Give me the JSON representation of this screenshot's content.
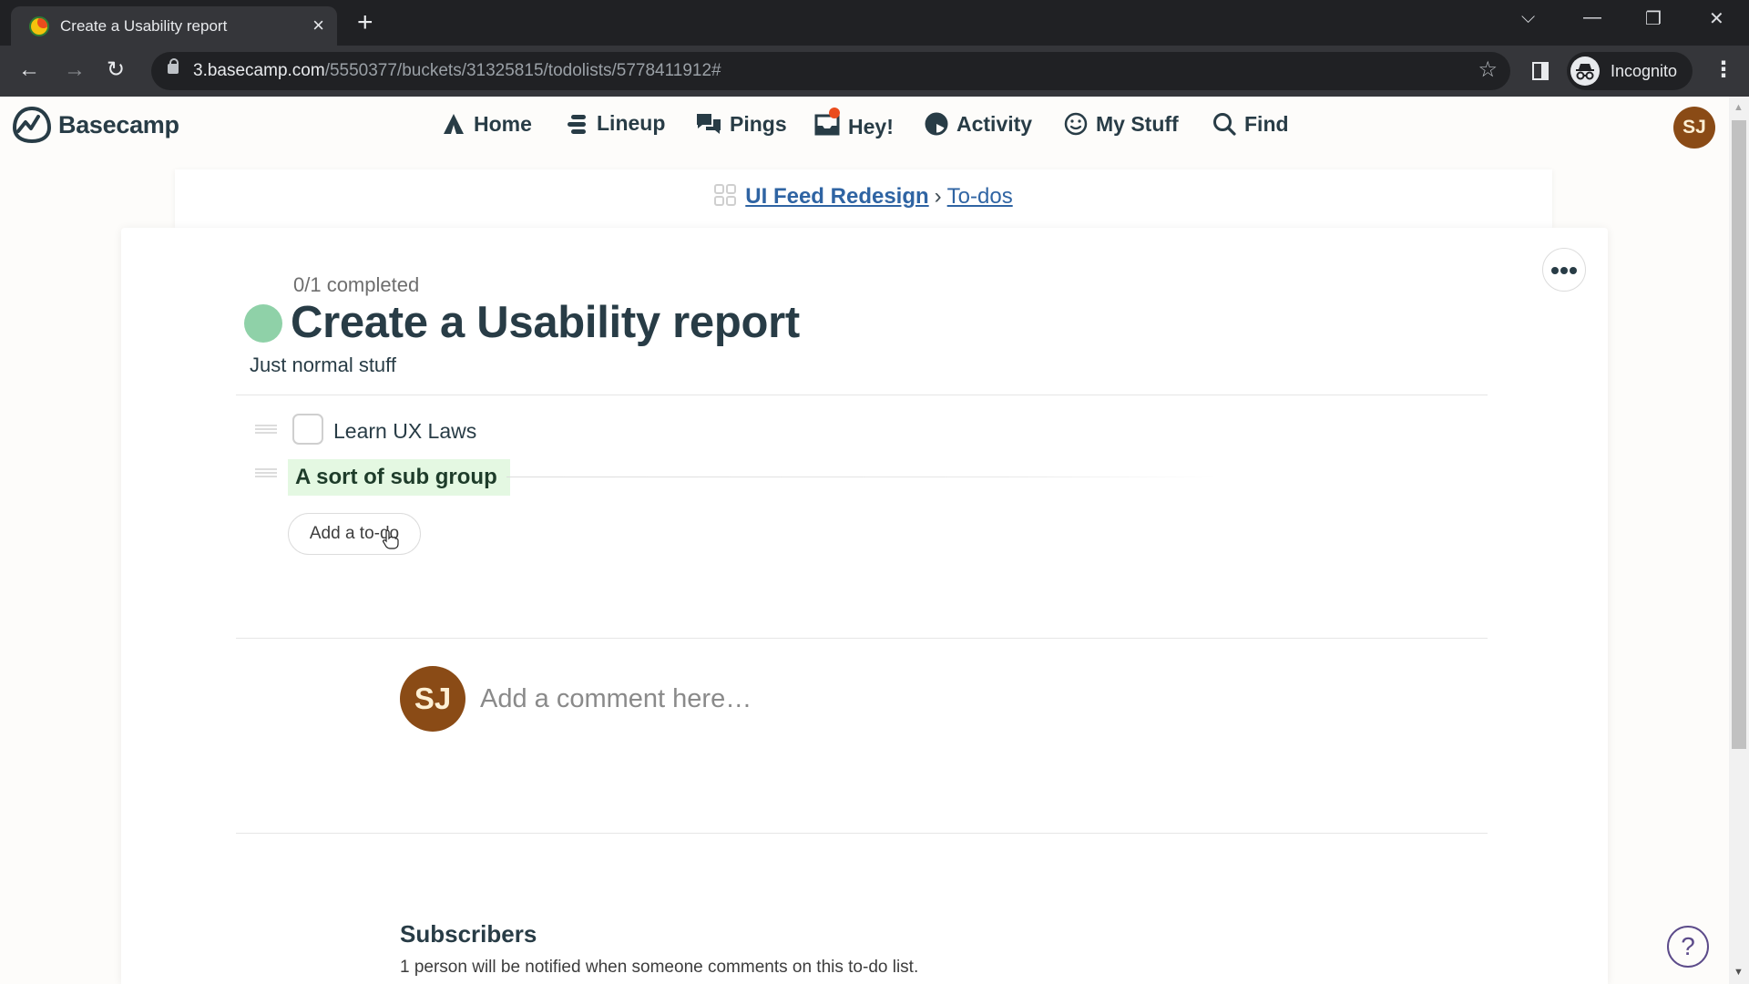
{
  "browser": {
    "tab_title": "Create a Usability report",
    "tab_close": "×",
    "new_tab": "+",
    "url_host": "3.basecamp.com",
    "url_path": "/5550377/buckets/31325815/todolists/5778411912#",
    "profile_label": "Incognito",
    "window_controls": {
      "tab_search": "⌵",
      "minimize": "—",
      "restore": "❐",
      "close": "✕"
    },
    "nav": {
      "back": "←",
      "forward": "→",
      "reload": "↻"
    },
    "star": "☆",
    "menu": "⋮"
  },
  "app": {
    "brand": "Basecamp",
    "nav": [
      {
        "id": "home",
        "label": "Home",
        "icon": "home-icon"
      },
      {
        "id": "lineup",
        "label": "Lineup",
        "icon": "lineup-icon"
      },
      {
        "id": "pings",
        "label": "Pings",
        "icon": "pings-icon"
      },
      {
        "id": "hey",
        "label": "Hey!",
        "icon": "hey-inbox-icon",
        "has_notification": true
      },
      {
        "id": "activity",
        "label": "Activity",
        "icon": "activity-icon"
      },
      {
        "id": "mystuff",
        "label": "My Stuff",
        "icon": "smiley-icon"
      },
      {
        "id": "find",
        "label": "Find",
        "icon": "search-icon"
      }
    ],
    "user_initials": "SJ",
    "colors": {
      "avatar": "#8a4b16",
      "notification": "#ea4c1d",
      "link": "#2f64a3",
      "status_dot": "#8fd1a8",
      "group_bg": "#e4f8e2"
    }
  },
  "breadcrumb": {
    "project": "UI Feed Redesign",
    "separator": "›",
    "section": "To-dos"
  },
  "todolist": {
    "progress_text": "0/1 completed",
    "progress": {
      "done": 0,
      "total": 1
    },
    "title": "Create a Usability report",
    "description": "Just normal stuff",
    "items": [
      {
        "label": "Learn UX Laws",
        "checked": false
      }
    ],
    "groups": [
      {
        "label": "A sort of sub group"
      }
    ],
    "add_todo_label": "Add a to-do"
  },
  "comment": {
    "avatar_initials": "SJ",
    "placeholder": "Add a comment here…"
  },
  "subscribers": {
    "title": "Subscribers",
    "text": "1 person will be notified when someone comments on this to-do list."
  },
  "help": {
    "label": "?"
  }
}
